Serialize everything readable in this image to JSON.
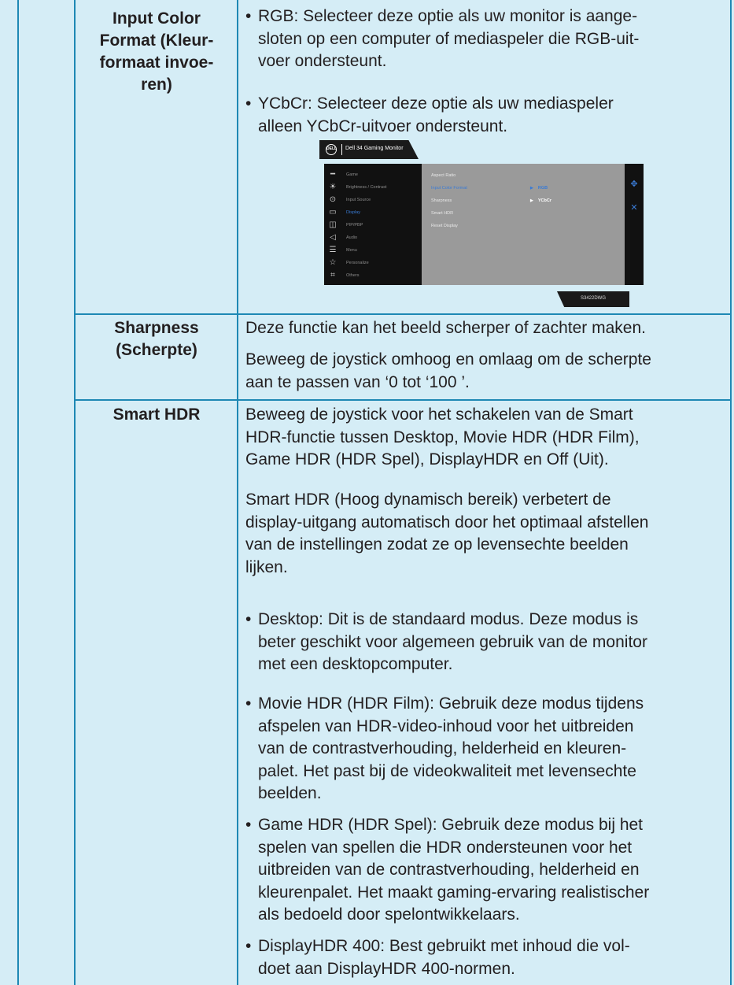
{
  "rows": {
    "input_color_format": {
      "label": [
        "Input Color",
        "Format (Kleur-",
        "formaat invoe-",
        "ren)"
      ],
      "bullets": [
        {
          "term": "RGB:",
          "lines": [
            " Selecteer deze optie als uw monitor is aange-",
            "sloten op een computer of mediaspeler die RGB-uit-",
            "voer ondersteunt."
          ]
        },
        {
          "term": "YCbCr:",
          "lines": [
            " Selecteer deze optie als uw mediaspeler",
            "alleen YCbCr-uitvoer ondersteunt."
          ]
        }
      ]
    },
    "sharpness": {
      "label": [
        "Sharpness",
        "(Scherpte)"
      ],
      "paragraphs": [
        [
          "Deze functie kan het beeld scherper of zachter maken."
        ],
        [
          "Beweeg de joystick omhoog en omlaag om de scherpte",
          "aan te passen van ‘0 tot ‘100 ’."
        ]
      ]
    },
    "smart_hdr": {
      "label": [
        "Smart HDR"
      ],
      "paragraphs": [
        [
          "Beweeg de joystick voor het schakelen van de Smart",
          "HDR-functie tussen Desktop, Movie HDR (HDR Film),",
          "Game HDR (HDR Spel), DisplayHDR en Off (Uit)."
        ],
        [
          "Smart HDR (Hoog dynamisch bereik) verbetert de",
          "display-uitgang automatisch door het optimaal afstellen",
          "van de instellingen zodat ze op levensechte beelden",
          "lijken."
        ]
      ],
      "bullets": [
        {
          "term": "Desktop:",
          "lines": [
            " Dit is de standaard modus. Deze modus is",
            "beter geschikt voor algemeen gebruik van de monitor",
            "met een desktopcomputer."
          ]
        },
        {
          "term": "Movie HDR (HDR Film):",
          "lines": [
            " Gebruik deze modus tijdens",
            "afspelen van HDR-video-inhoud voor het uitbreiden",
            "van de contrastverhouding, helderheid en kleuren-",
            "palet. Het past bij de videokwaliteit met levensechte",
            "beelden."
          ]
        },
        {
          "term": "Game HDR (HDR Spel):",
          "lines": [
            " Gebruik deze modus bij het",
            "spelen van spellen die HDR ondersteunen voor het",
            "uitbreiden van de contrastverhouding, helderheid en",
            "kleurenpalet. Het maakt gaming-ervaring realistischer",
            "als bedoeld door spelontwikkelaars."
          ]
        },
        {
          "term": "DisplayHDR 400:",
          "lines": [
            " Best gebruikt met inhoud die vol-",
            "doet aan DisplayHDR 400-normen."
          ]
        }
      ]
    }
  },
  "osd": {
    "brand": "DELL",
    "title": "Dell 34 Gaming Monitor",
    "model": "S3422DWG",
    "menu": [
      {
        "label": "Game",
        "icon": "game-icon",
        "glyph": "━"
      },
      {
        "label": "Brightness / Contrast",
        "icon": "brightness-icon",
        "glyph": "☀"
      },
      {
        "label": "Input Source",
        "icon": "input-source-icon",
        "glyph": "⊙"
      },
      {
        "label": "Display",
        "icon": "display-icon",
        "glyph": "▭"
      },
      {
        "label": "PIP/PBP",
        "icon": "pip-icon",
        "glyph": "◫"
      },
      {
        "label": "Audio",
        "icon": "audio-icon",
        "glyph": "◁"
      },
      {
        "label": "Menu",
        "icon": "menu-icon",
        "glyph": "☰"
      },
      {
        "label": "Personalize",
        "icon": "star-icon",
        "glyph": "☆"
      },
      {
        "label": "Others",
        "icon": "others-icon",
        "glyph": "⌗"
      }
    ],
    "options": [
      "Aspect Ratio",
      "Input Color Format",
      "Sharpness",
      "Smart HDR",
      "Reset Display"
    ],
    "values": [
      "RGB",
      "YCbCr"
    ],
    "accent": "#3a7bd5"
  }
}
